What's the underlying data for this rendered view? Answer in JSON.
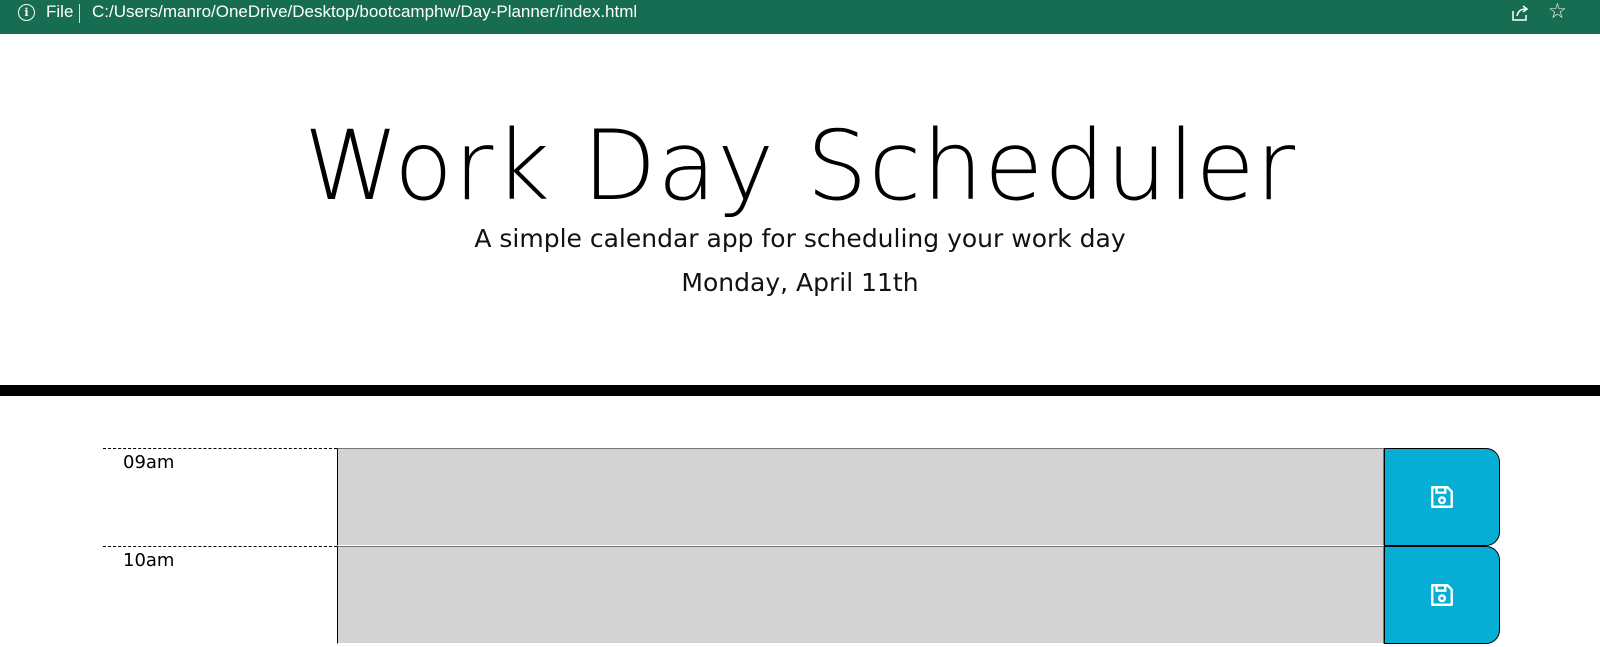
{
  "browser": {
    "file_label": "File",
    "url": "C:/Users/manro/OneDrive/Desktop/bootcamphw/Day-Planner/index.html",
    "info_icon": "info-icon",
    "share_icon": "share-icon",
    "star_icon": "star-icon",
    "bar_color": "#166d52"
  },
  "header": {
    "title": "Work Day Scheduler",
    "lead": "A simple calendar app for scheduling your work day",
    "current_day": "Monday, April 11th"
  },
  "timeblocks": [
    {
      "hour": "09am",
      "text": "",
      "save_icon": "save-icon"
    },
    {
      "hour": "10am",
      "text": "",
      "save_icon": "save-icon"
    }
  ],
  "colors": {
    "past": "#d3d3d3",
    "save_button": "#06aed5",
    "header_border": "#000000"
  }
}
